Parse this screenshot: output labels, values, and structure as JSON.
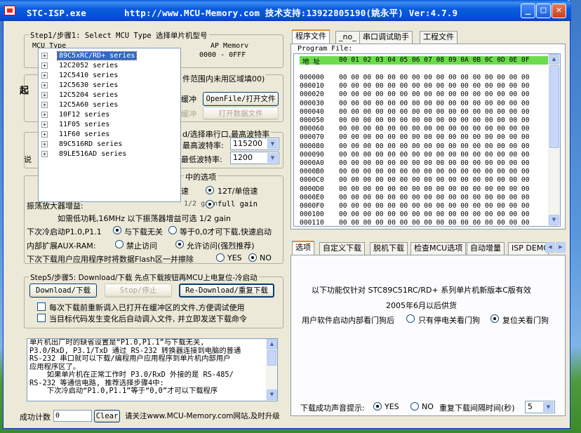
{
  "window": {
    "title": "STC-ISP.exe       http://www.MCU-Memory.com 技术支持:13922805190(姚永平) Ver:4.7.9"
  },
  "step1": {
    "label": "Step1/步骤1: Select MCU Type  选择单片机型号",
    "col_mcu": "MCU Type",
    "col_ap": "AP Memorv",
    "ap_value": "0000  - 0FFF",
    "tree_items": [
      "89C5xRC/RD+ series",
      "12C2052 series",
      "12C5410 series",
      "12C5630 series",
      "12C5204 series",
      "12C5A60 series",
      "10F12 series",
      "11F05 series",
      "11F60 series",
      "89C516RD series",
      "89LE516AD series"
    ],
    "selected": "89C5xRC/RD+ series"
  },
  "step2": {
    "hint_fragment": "件范围内未用区域填00)",
    "buffer_fragment": "缓冲",
    "buffer_fragment2": "缓冲",
    "open_file": "OpenFile/打开文件",
    "open_data": "打开数据文件"
  },
  "step3": {
    "label_fragment": "d/选择串行口,最高波特率",
    "max_baud_label": "最高波特率:",
    "max_baud": "115200",
    "min_baud_label": "最低波特率:",
    "min_baud": "1200",
    "left_fragment": "说"
  },
  "step4": {
    "label_fragment": "中的选项",
    "opt_12t": "12T/单倍速",
    "opt_full_gain": "full gain",
    "opt_half_gain": "1/2 gain",
    "osc_label": "振荡放大器增益:",
    "speed_fragment": "速",
    "low_power": "如需低功耗,16MHz 以下振荡器增益可选 1/2 gain",
    "p1_label": "下次冷启动P1.0,P1.1",
    "p1_opt1": "与下载无关",
    "p1_opt2": "等于0,0才可下载,快速启动",
    "aux_label": "内部扩展AUX-RAM:",
    "aux_opt1": "禁止访问",
    "aux_opt2": "允许访问(强烈推荐)",
    "flash_label": "下次下载用户应用程序时将数据Flash区一并擦除",
    "flash_yes": "YES",
    "flash_no": "NO"
  },
  "step5": {
    "label": "Step5/步骤5: Download/下载  先点下载按钮再MCU上电复位-冷启动",
    "download": "Download/下载",
    "stop": "Stop/停止",
    "redownload": "Re-Download/重复下载",
    "chk1": "每次下载前重新调入已打开在缓冲区的文件,方便调试使用",
    "chk2": "当目标代码发生变化后自动调入文件, 并立即发送下载命令"
  },
  "info_text": [
    "单片机出厂时的缺省设置是“P1.0,P1.1”与下载无关,",
    "P3.0/RxD, P3.1/TxD 通过 RS-232 转换器连接到电脑的普通",
    "RS-232 串口就可以下载/编程用户应用程序到单片机内部用户",
    "应用程序区了。",
    "    如果单片机在正常工作时 P3.0/RxD 外接的是 RS-485/",
    "RS-232 等通信电路, 推荐选择步骤4中:",
    "    下次冷启动“P1.0,P1.1”等于“0,0”才可以下载程序"
  ],
  "bottom": {
    "count_label": "成功计数",
    "count_value": "0",
    "clear": "Clear",
    "visit": "请关注www.MCU-Memory.com网站,及时升级"
  },
  "top_tabs": [
    "程序文件",
    "_no_",
    "串口调试助手",
    "工程文件"
  ],
  "program_file_label": "Program File:",
  "hex": {
    "addr_label": "地 址",
    "header": "00 01 02 03 04 05 06 07 08 09 0A 0B 0C 0D 0E 0F",
    "rows": [
      "000000",
      "000010",
      "000020",
      "000030",
      "000040",
      "000050",
      "000060",
      "000070",
      "000080",
      "000090",
      "0000A0",
      "0000B0",
      "0000C0",
      "0000D0",
      "0000E0",
      "0000F0",
      "000100",
      "000110"
    ],
    "row_data": "00 00 00 00 00 00 00 00 00 00 00 00 00 00 00 00"
  },
  "bottom_tabs": [
    "选项",
    "自定义下载",
    "脱机下载",
    "检查MCU选项",
    "自动增量",
    "ISP DEMO"
  ],
  "options": {
    "line1": "以下功能仅针对 STC89C51RC/RD+ 系列单片机新版本C版有效",
    "line2": "2005年6月以后供货",
    "wd_label": "用户软件启动内部看门狗后",
    "wd_opt1": "只有停电关看门狗",
    "wd_opt2": "复位关看门狗"
  },
  "sound": {
    "label": "下载成功声音提示:",
    "yes": "YES",
    "no": "NO",
    "interval_label": "重复下载间隔时间(秒)",
    "interval": "5"
  }
}
